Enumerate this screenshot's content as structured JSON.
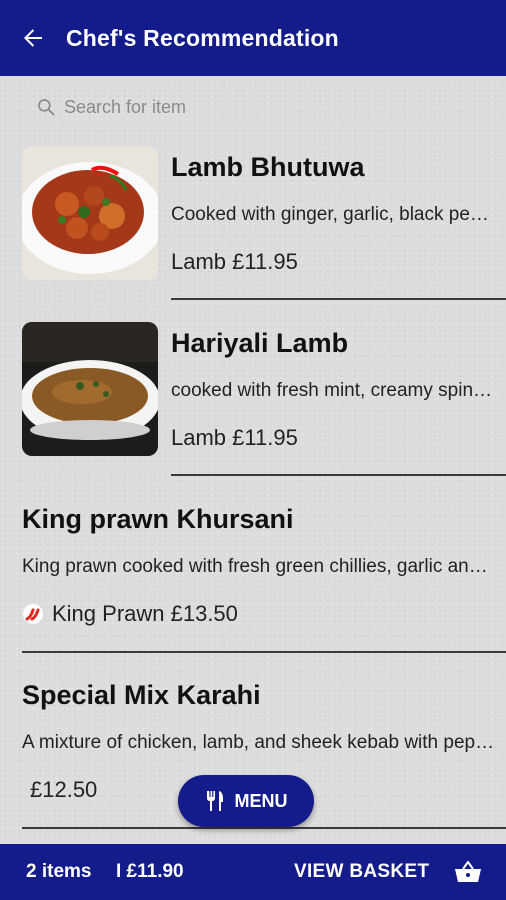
{
  "appbar": {
    "title": "Chef's Recommendation",
    "back_icon": "arrow-left-icon"
  },
  "search": {
    "placeholder": "Search for item",
    "icon": "search-icon"
  },
  "items": [
    {
      "name": "Lamb Bhutuwa",
      "description": "Cooked with ginger, garlic, black pepper, onion and tomato",
      "price": "Lamb £11.95",
      "has_image": true,
      "image_icon": "curry-dish-image"
    },
    {
      "name": "Hariyali Lamb",
      "description": "cooked with fresh mint, creamy spinach and herbs",
      "price": "Lamb £11.95",
      "has_image": true,
      "image_icon": "curry-bowl-image"
    },
    {
      "name": "King prawn Khursani",
      "description": "King prawn cooked with fresh green chillies, garlic and ginger",
      "price": "King Prawn £13.50",
      "spicy": true,
      "spicy_icon": "chilli-icon"
    },
    {
      "name": "Special Mix Karahi",
      "description": "A mixture of chicken, lamb, and sheek kebab with peppers and onions",
      "price": "£12.50"
    }
  ],
  "menu_button": {
    "label": "MENU",
    "icon": "cutlery-icon"
  },
  "bottombar": {
    "count": "2 items",
    "total": "I £11.90",
    "view_label": "VIEW BASKET",
    "basket_icon": "basket-icon"
  },
  "colors": {
    "primary": "#131c8a",
    "background": "#dcdcdc",
    "chilli": "#e0281e"
  }
}
